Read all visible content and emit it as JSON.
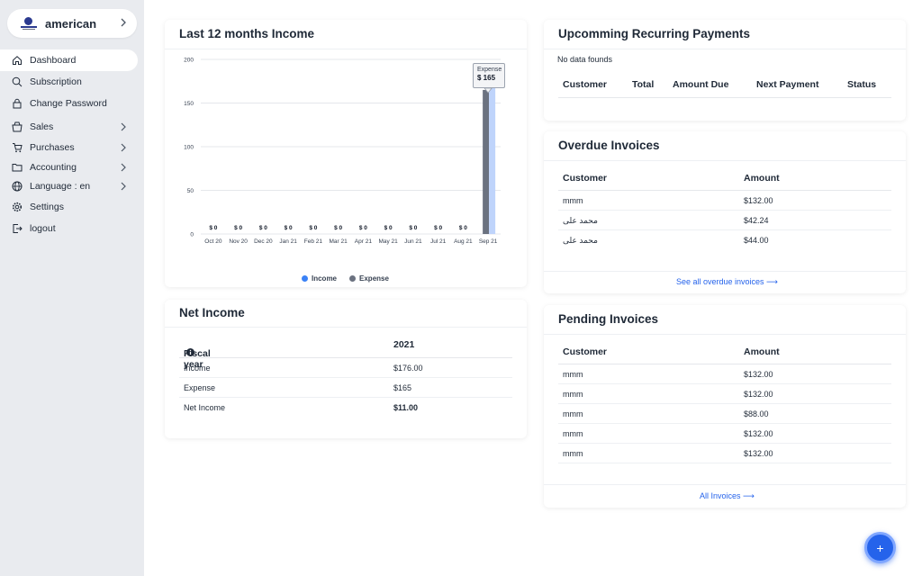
{
  "org": {
    "name": "american"
  },
  "nav": [
    {
      "label": "Dashboard",
      "icon": "home-icon",
      "active": true,
      "chevron": false
    },
    {
      "label": "Subscription",
      "icon": "subscription-icon",
      "active": false,
      "chevron": false
    },
    {
      "label": "Change Password",
      "icon": "lock-icon",
      "active": false,
      "chevron": false
    },
    {
      "label": "Sales",
      "icon": "sales-icon",
      "active": false,
      "chevron": true
    },
    {
      "label": "Purchases",
      "icon": "cart-icon",
      "active": false,
      "chevron": true
    },
    {
      "label": "Accounting",
      "icon": "folder-icon",
      "active": false,
      "chevron": true
    },
    {
      "label": "Language : en",
      "icon": "globe-icon",
      "active": false,
      "chevron": true
    },
    {
      "label": "Settings",
      "icon": "gear-icon",
      "active": false,
      "chevron": false
    },
    {
      "label": "logout",
      "icon": "logout-icon",
      "active": false,
      "chevron": false
    }
  ],
  "income_card": {
    "title": "Last 12 months Income"
  },
  "chart_data": {
    "type": "bar",
    "categories": [
      "Oct 20",
      "Nov 20",
      "Dec 20",
      "Jan 21",
      "Feb 21",
      "Mar 21",
      "Apr 21",
      "May 21",
      "Jun 21",
      "Jul 21",
      "Aug 21",
      "Sep 21"
    ],
    "series": [
      {
        "name": "Income",
        "color": "#3b82f6",
        "values": [
          0,
          0,
          0,
          0,
          0,
          0,
          0,
          0,
          0,
          0,
          0,
          176
        ]
      },
      {
        "name": "Expense",
        "color": "#6b7280",
        "values": [
          0,
          0,
          0,
          0,
          0,
          0,
          0,
          0,
          0,
          0,
          0,
          165
        ]
      }
    ],
    "data_labels": [
      "$ 0",
      "$ 0",
      "$ 0",
      "$ 0",
      "$ 0",
      "$ 0",
      "$ 0",
      "$ 0",
      "$ 0",
      "$ 0",
      "$ 0"
    ],
    "yticks": [
      0,
      50,
      100,
      150,
      200
    ],
    "ylim": [
      0,
      200
    ],
    "legend_position": "bottom",
    "grid": true,
    "tooltip": {
      "label": "Expense",
      "value": "$ 165"
    }
  },
  "recurring": {
    "title": "Upcomming Recurring Payments",
    "empty_text": "No data founds",
    "columns": [
      "Customer",
      "Total",
      "Amount Due",
      "Next Payment",
      "Status"
    ]
  },
  "overdue": {
    "title": "Overdue Invoices",
    "columns": [
      "Customer",
      "Amount"
    ],
    "rows": [
      {
        "customer": "mmm",
        "amount": "$132.00"
      },
      {
        "customer": "محمد على",
        "amount": "$42.24"
      },
      {
        "customer": "محمد على",
        "amount": "$44.00"
      }
    ],
    "link": "See all overdue invoices ⟶"
  },
  "net_income": {
    "title": "Net Income",
    "fiscal_label": "Fiscal year",
    "year": "2021",
    "rows": [
      {
        "label": "Income",
        "value": "$176.00"
      },
      {
        "label": "Expense",
        "value": "$165"
      },
      {
        "label": "Net Income",
        "value": "$11.00"
      }
    ]
  },
  "pending": {
    "title": "Pending Invoices",
    "columns": [
      "Customer",
      "Amount"
    ],
    "rows": [
      {
        "customer": "mmm",
        "amount": "$132.00"
      },
      {
        "customer": "mmm",
        "amount": "$132.00"
      },
      {
        "customer": "mmm",
        "amount": "$88.00"
      },
      {
        "customer": "mmm",
        "amount": "$132.00"
      },
      {
        "customer": "mmm",
        "amount": "$132.00"
      }
    ],
    "link": "All Invoices ⟶"
  },
  "fab": {
    "label": "+"
  }
}
